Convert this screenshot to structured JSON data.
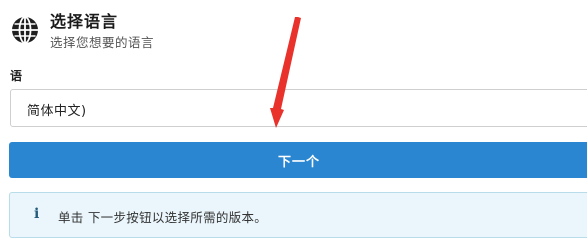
{
  "header": {
    "title": "选择语言",
    "subtitle": "选择您想要的语言",
    "icon": "globe-icon"
  },
  "language_field": {
    "label": "语",
    "selected_value": "简体中文)"
  },
  "next_button": {
    "label": "下一个"
  },
  "info_box": {
    "icon": "info-icon",
    "icon_glyph": "i",
    "text": "单击 下一步按钮以选择所需的版本。"
  },
  "colors": {
    "button_bg": "#2a86d1",
    "info_bg": "#eaf6fb",
    "info_border": "#b9dcea",
    "annotation_arrow": "#e8322b"
  }
}
